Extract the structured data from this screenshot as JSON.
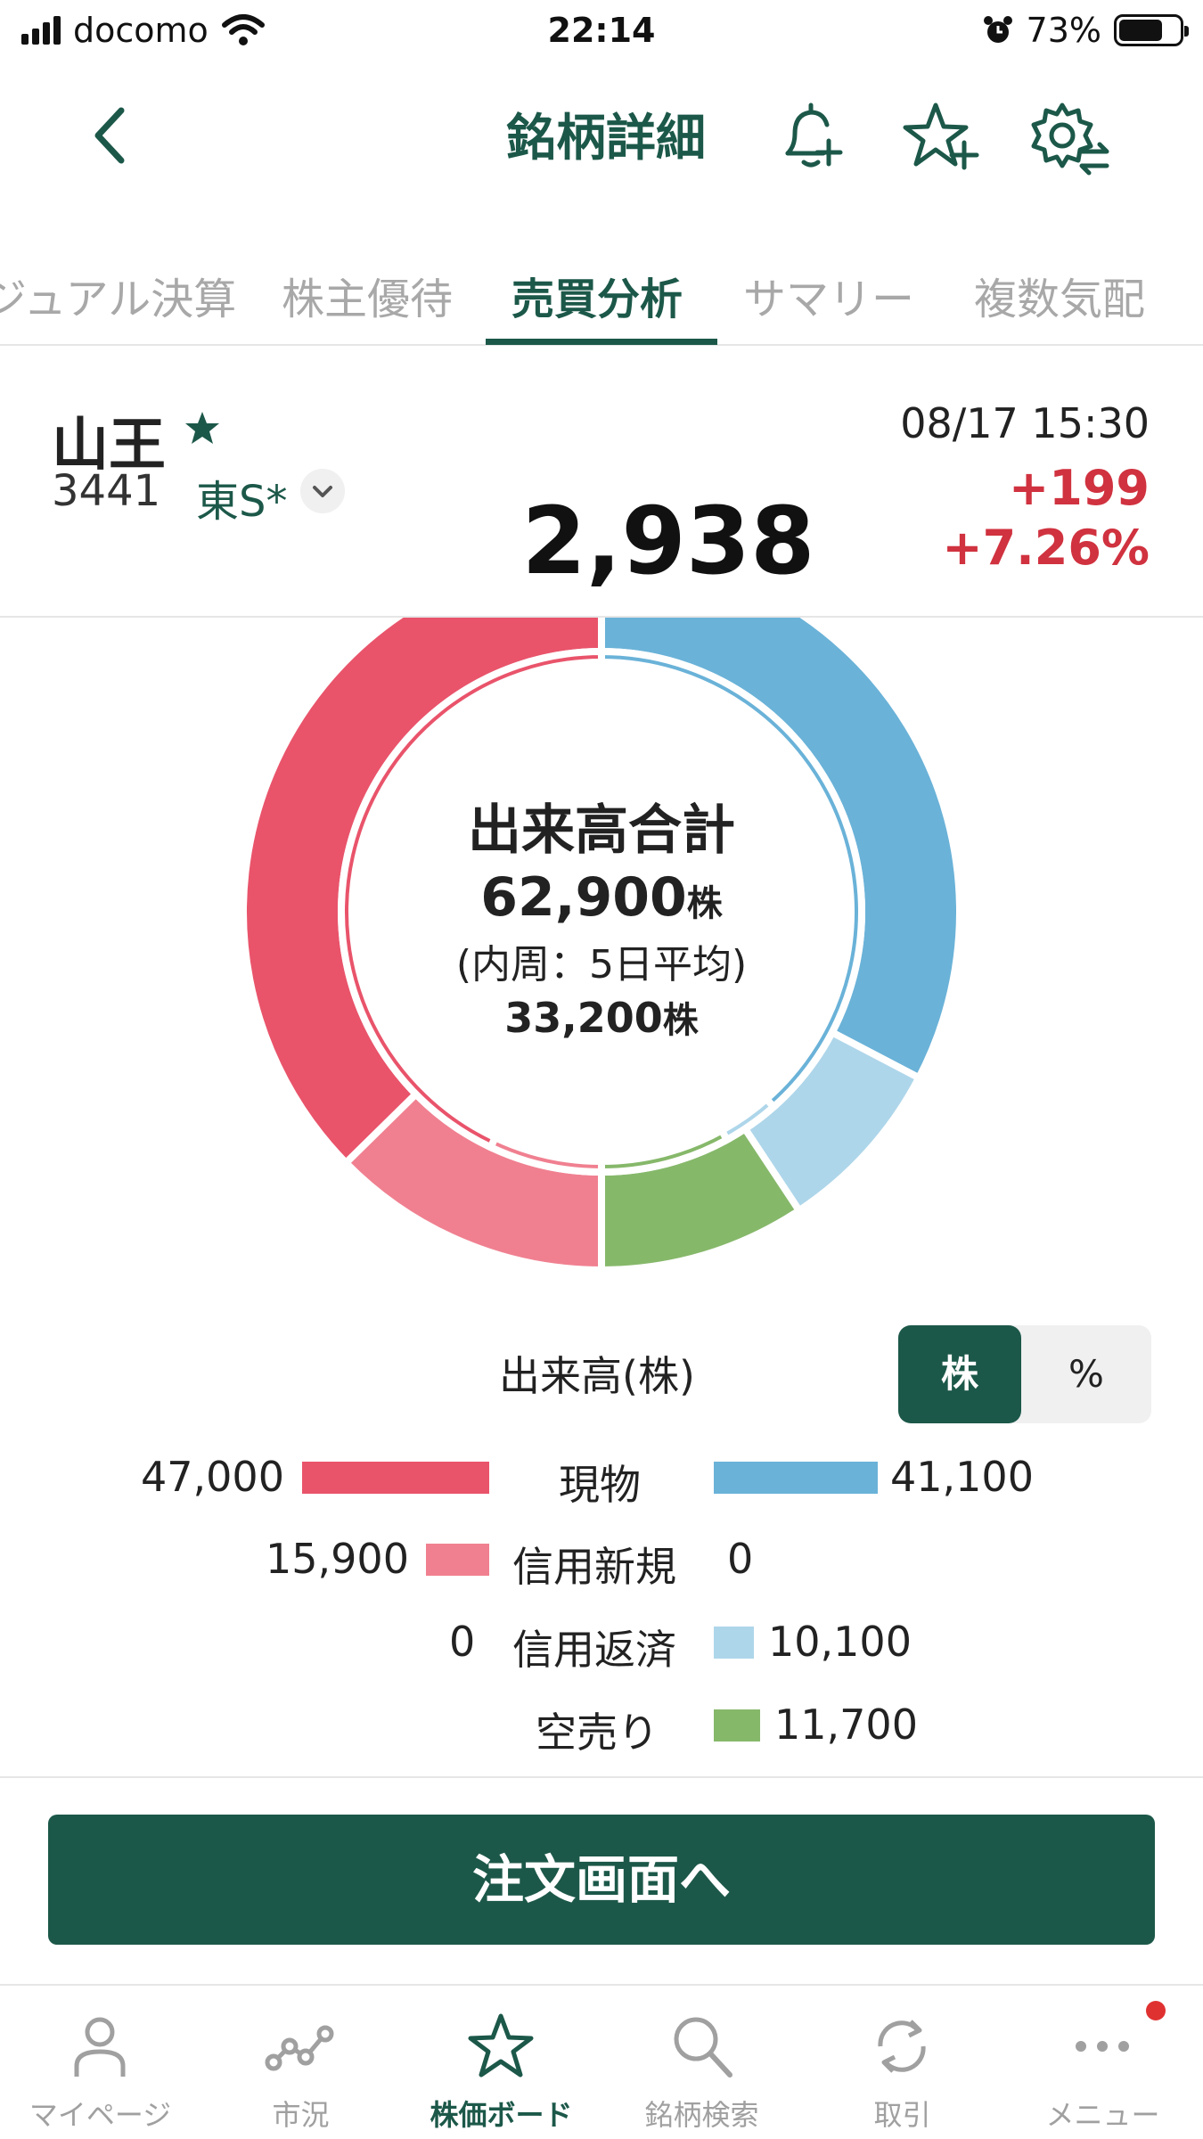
{
  "status_bar": {
    "carrier": "docomo",
    "time": "22:14",
    "battery": "73%",
    "battery_level": 0.73
  },
  "nav": {
    "title": "銘柄詳細",
    "icons": [
      "chevron-left-icon",
      "bell-plus-icon",
      "star-plus-icon",
      "gear-swap-icon"
    ]
  },
  "tabs": [
    {
      "label": "ジュアル決算"
    },
    {
      "label": "株主優待"
    },
    {
      "label": "売買分析"
    },
    {
      "label": "サマリー"
    },
    {
      "label": "複数気配"
    }
  ],
  "stock": {
    "name": "山王",
    "code": "3441",
    "market": "東S*",
    "datetime": "08/17 15:30",
    "change": "+199",
    "change_pct": "+7.26%",
    "price": "2,938",
    "up_color": "#d0323f"
  },
  "donut": {
    "title": "出来高合計",
    "total": "62,900",
    "unit": "株",
    "sub_label": "(内周：5日平均)",
    "avg": "33,200"
  },
  "volume": {
    "title": "出来高(株)",
    "toggle": {
      "shares": "株",
      "percent": "%"
    },
    "rows": [
      {
        "label": "現物",
        "buy": "47,000",
        "sell": "41,100"
      },
      {
        "label": "信用新規",
        "buy": "15,900",
        "sell": "0"
      },
      {
        "label": "信用返済",
        "buy": "0",
        "sell": "10,100"
      },
      {
        "label": "空売り",
        "sell": "11,700"
      }
    ],
    "colors": {
      "cash_buy": "#e9546b",
      "margin_new_buy": "#f08090",
      "cash_sell": "#6ab2d8",
      "margin_close_sell": "#aed6ea",
      "short_sell": "#86b86a"
    }
  },
  "chart_data": {
    "type": "pie",
    "title": "出来高合計",
    "outer": {
      "total": 62900,
      "buy": [
        {
          "name": "現物",
          "value": 47000
        },
        {
          "name": "信用新規",
          "value": 15900
        }
      ],
      "sell": [
        {
          "name": "現物",
          "value": 41100
        },
        {
          "name": "信用返済",
          "value": 10100
        },
        {
          "name": "空売り",
          "value": 11700
        }
      ]
    },
    "inner": {
      "total": 33200,
      "buy": [
        {
          "name": "現物",
          "value": 0.86
        },
        {
          "name": "信用新規",
          "value": 0.14
        }
      ],
      "sell": [
        {
          "name": "現物",
          "value": 0.77
        },
        {
          "name": "信用返済",
          "value": 0.07
        },
        {
          "name": "空売り",
          "value": 0.16
        }
      ]
    }
  },
  "order_button": "注文画面へ",
  "tabbar": [
    {
      "label": "マイページ",
      "icon": "person-icon"
    },
    {
      "label": "市況",
      "icon": "market-chart-icon"
    },
    {
      "label": "株価ボード",
      "icon": "star-board-icon"
    },
    {
      "label": "銘柄検索",
      "icon": "search-icon"
    },
    {
      "label": "取引",
      "icon": "refresh-icon"
    },
    {
      "label": "メニュー",
      "icon": "more-icon"
    }
  ]
}
